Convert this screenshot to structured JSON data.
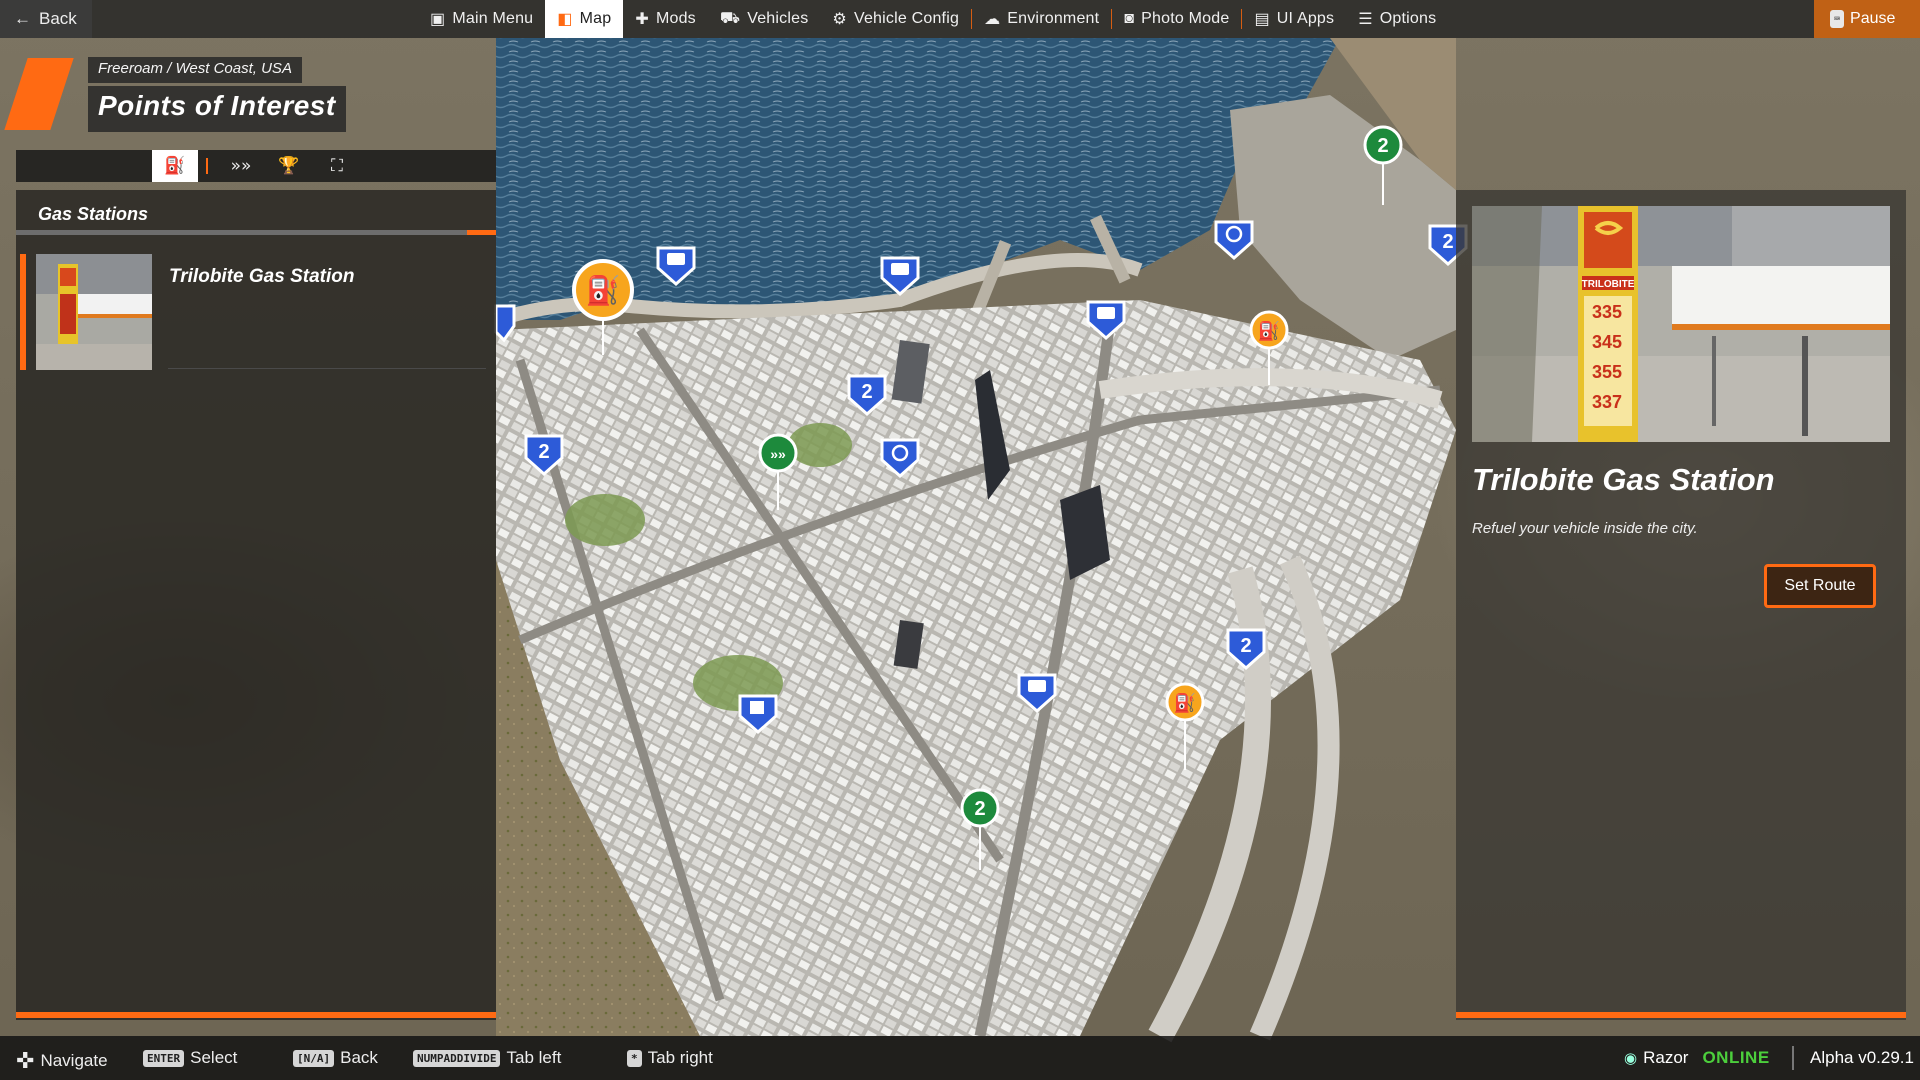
{
  "topbar": {
    "back_label": "Back",
    "menu": [
      {
        "label": "Main Menu",
        "icon": "grid-plus-icon",
        "glyph": "▣"
      },
      {
        "label": "Map",
        "icon": "map-icon",
        "glyph": "◧",
        "active": true
      },
      {
        "label": "Mods",
        "icon": "puzzle-icon",
        "glyph": "✚"
      },
      {
        "label": "Vehicles",
        "icon": "car-icon",
        "glyph": "⛟"
      },
      {
        "label": "Vehicle Config",
        "icon": "engine-icon",
        "glyph": "⚙"
      },
      {
        "label": "Environment",
        "icon": "weather-icon",
        "glyph": "☁"
      },
      {
        "label": "Photo Mode",
        "icon": "camera-icon",
        "glyph": "◙"
      },
      {
        "label": "UI Apps",
        "icon": "apps-icon",
        "glyph": "▤"
      },
      {
        "label": "Options",
        "icon": "sliders-icon",
        "glyph": "☰"
      }
    ],
    "pause_label": "Pause"
  },
  "header": {
    "breadcrumb": "Freeroam / West Coast, USA",
    "title": "Points of Interest"
  },
  "left_tabs": [
    {
      "icon": "gas-station-icon",
      "glyph": "⛽",
      "active": true
    },
    {
      "icon": "chevrons-right-icon",
      "glyph": "»»"
    },
    {
      "icon": "trophy-icon",
      "glyph": "🏆"
    },
    {
      "icon": "garage-icon",
      "glyph": "⛶"
    }
  ],
  "left_panel": {
    "category": "Gas Stations",
    "items": [
      {
        "name": "Trilobite Gas Station",
        "selected": true
      }
    ]
  },
  "detail": {
    "title": "Trilobite Gas Station",
    "description": "Refuel your vehicle inside the city.",
    "button_label": "Set Route",
    "sign_brand": "TRILOBITE",
    "prices": [
      "335",
      "345",
      "355",
      "337"
    ]
  },
  "map_markers": {
    "gas_label": "⛽",
    "speed_label": "2",
    "bus_label": "🚌"
  },
  "bottombar": {
    "hints": [
      {
        "key": "✜",
        "label": "Navigate"
      },
      {
        "key": "ENTER",
        "label": "Select"
      },
      {
        "key": "[N/A]",
        "label": "Back"
      },
      {
        "key": "NUMPADDIVIDE",
        "label": "Tab left"
      },
      {
        "key": "*",
        "label": "Tab right"
      }
    ],
    "user": "Razor",
    "status": "ONLINE",
    "version": "Alpha v0.29.1"
  },
  "colors": {
    "accent": "#ff6a13",
    "online": "#4ccf3c",
    "water": "#2f5a78"
  }
}
